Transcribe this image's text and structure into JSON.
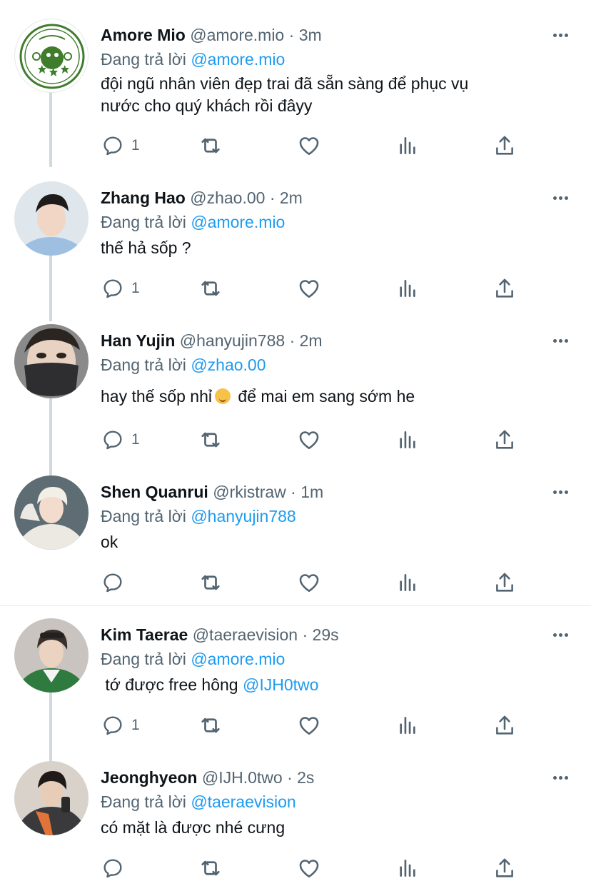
{
  "replying_prefix": "Đang trả lời",
  "tweets": [
    {
      "name": "Amore Mio",
      "handle": "@amore.mio",
      "time": "3m",
      "reply_to": "@amore.mio",
      "text_lines": [
        "đội ngũ nhân viên đẹp trai đã sẵn sàng để phục vụ",
        "nước cho quý khách rồi đâyy"
      ],
      "reply_count": "1"
    },
    {
      "name": "Zhang Hao",
      "handle": "@zhao.00",
      "time": "2m",
      "reply_to": "@amore.mio",
      "text": "thế hả sốp ?",
      "reply_count": "1"
    },
    {
      "name": "Han Yujin",
      "handle": "@hanyujin788",
      "time": "2m",
      "reply_to": "@zhao.00",
      "text_before_emoji": "hay thế sốp nhỉ",
      "text_after_emoji": " để mai em sang sớm he",
      "reply_count": "1"
    },
    {
      "name": "Shen Quanrui",
      "handle": "@rkistraw",
      "time": "1m",
      "reply_to": "@hanyujin788",
      "text": "ok",
      "reply_count": ""
    },
    {
      "name": "Kim Taerae",
      "handle": "@taeraevision",
      "time": "29s",
      "reply_to": "@amore.mio",
      "text": " tớ được free hông ",
      "mention": "@IJH0two",
      "reply_count": "1"
    },
    {
      "name": "Jeonghyeon",
      "handle": "@IJH.0two",
      "time": "2s",
      "reply_to": "@taeraevision",
      "text": "có mặt là được nhé cưng",
      "reply_count": ""
    }
  ],
  "colors": {
    "link": "#1d9bf0",
    "muted": "#536471",
    "text": "#0f1419",
    "thread_line": "#cfd9de"
  },
  "icons": [
    "more-icon",
    "reply-icon",
    "retweet-icon",
    "like-icon",
    "views-icon",
    "share-icon"
  ]
}
